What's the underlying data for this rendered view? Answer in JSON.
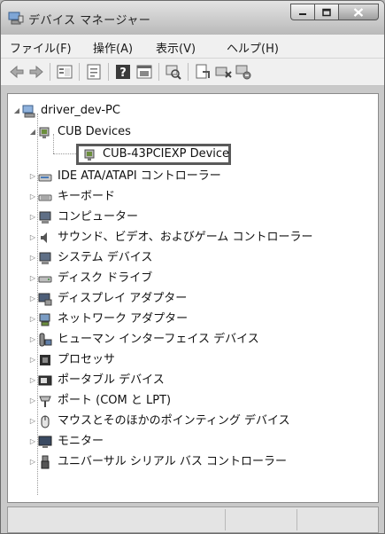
{
  "window": {
    "title": "デバイス マネージャー"
  },
  "menu": [
    {
      "label": "ファイル(F)"
    },
    {
      "label": "操作(A)"
    },
    {
      "label": "表示(V)"
    },
    {
      "label": "ヘルプ(H)"
    }
  ],
  "toolbar": {
    "buttons": [
      "back-arrow-icon",
      "forward-arrow-icon",
      "show-hide-tree-icon",
      "properties-icon",
      "help-icon",
      "view-icon",
      "scan-hardware-icon",
      "update-driver-icon",
      "disable-device-icon",
      "uninstall-device-icon"
    ]
  },
  "tree": {
    "root": {
      "label": "driver_dev-PC",
      "expanded": true
    },
    "cub_devices": {
      "label": "CUB Devices",
      "expanded": true
    },
    "selected_device": {
      "label": "CUB-43PCIEXP Device",
      "selected": true
    },
    "categories": [
      {
        "label": "IDE ATA/ATAPI コントローラー",
        "icon": "ide-controller-icon"
      },
      {
        "label": "キーボード",
        "icon": "keyboard-icon"
      },
      {
        "label": "コンピューター",
        "icon": "computer-icon"
      },
      {
        "label": "サウンド、ビデオ、およびゲーム コントローラー",
        "icon": "speaker-icon"
      },
      {
        "label": "システム デバイス",
        "icon": "system-device-icon"
      },
      {
        "label": "ディスク ドライブ",
        "icon": "disk-drive-icon"
      },
      {
        "label": "ディスプレイ アダプター",
        "icon": "display-adapter-icon"
      },
      {
        "label": "ネットワーク アダプター",
        "icon": "network-adapter-icon"
      },
      {
        "label": "ヒューマン インターフェイス デバイス",
        "icon": "hid-icon"
      },
      {
        "label": "プロセッサ",
        "icon": "processor-icon"
      },
      {
        "label": "ポータブル デバイス",
        "icon": "portable-device-icon"
      },
      {
        "label": "ポート (COM と LPT)",
        "icon": "port-icon"
      },
      {
        "label": "マウスとそのほかのポインティング デバイス",
        "icon": "mouse-icon"
      },
      {
        "label": "モニター",
        "icon": "monitor-icon"
      },
      {
        "label": "ユニバーサル シリアル バス コントローラー",
        "icon": "usb-icon"
      }
    ]
  },
  "colors": {
    "selection_border": "#5a5a5a",
    "tree_background": "#ffffff",
    "chrome": "#c9c9c9"
  }
}
